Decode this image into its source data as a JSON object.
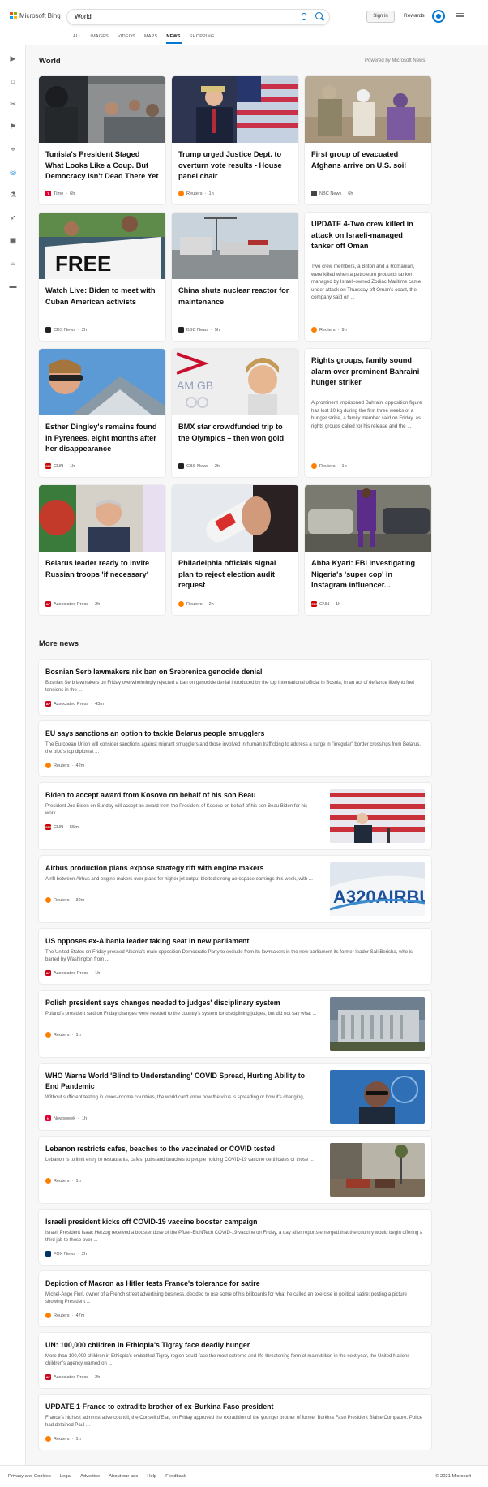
{
  "header": {
    "logo_text": "Microsoft Bing",
    "search_query": "World",
    "signin_label": "Sign in",
    "rewards_label": "Rewards",
    "tabs": [
      "ALL",
      "IMAGES",
      "VIDEOS",
      "MAPS",
      "NEWS",
      "SHOPPING"
    ],
    "active_tab": "NEWS"
  },
  "rail": [
    "expand-icon",
    "home-icon",
    "tools-icon",
    "flag-icon",
    "location-icon",
    "globe-icon",
    "science-icon",
    "rocket-icon",
    "entertainment-icon",
    "building-icon",
    "money-icon"
  ],
  "section": {
    "title": "World",
    "powered_by": "Powered by Microsoft News"
  },
  "cards": [
    {
      "title": "Tunisia's President Staged What Looks Like a Coup. But Democracy Isn't Dead There Yet",
      "snippet": "",
      "source": "Time",
      "age": "6h",
      "logo_color": "#e4002b"
    },
    {
      "title": "Trump urged Justice Dept. to overturn vote results - House panel chair",
      "snippet": "",
      "source": "Reuters",
      "age": "1h",
      "logo_color": "#ff8000"
    },
    {
      "title": "First group of evacuated Afghans arrive on U.S. soil",
      "snippet": "",
      "source": "NBC News",
      "age": "6h",
      "logo_color": "#444"
    },
    {
      "title": "Watch Live: Biden to meet with Cuban American activists",
      "snippet": "",
      "source": "CBS News",
      "age": "2h",
      "logo_color": "#222"
    },
    {
      "title": "China shuts nuclear reactor for maintenance",
      "snippet": "",
      "source": "BBC News",
      "age": "5h",
      "logo_color": "#222"
    },
    {
      "title": "UPDATE 4-Two crew killed in attack on Israeli-managed tanker off Oman",
      "snippet": "Two crew members, a Briton and a Romanian, were killed when a petroleum products tanker managed by Israeli-owned Zodiac Maritime came under attack on Thursday off Oman's coast, the company said on ...",
      "source": "Reuters",
      "age": "9h",
      "logo_color": "#ff8000"
    },
    {
      "title": "Esther Dingley's remains found in Pyrenees, eight months after her disappearance",
      "snippet": "",
      "source": "CNN",
      "age": "1h",
      "logo_color": "#cc0000"
    },
    {
      "title": "BMX star crowdfunded trip to the Olympics – then won gold",
      "snippet": "",
      "source": "CBS News",
      "age": "2h",
      "logo_color": "#222"
    },
    {
      "title": "Rights groups, family sound alarm over prominent Bahraini hunger striker",
      "snippet": "A prominent imprisoned Bahraini opposition figure has lost 10 kg during the first three weeks of a hunger strike, a family member said on Friday, as rights groups called for his release and the ...",
      "source": "Reuters",
      "age": "1h",
      "logo_color": "#ff8000"
    },
    {
      "title": "Belarus leader ready to invite Russian troops 'if necessary'",
      "snippet": "",
      "source": "Associated Press",
      "age": "2h",
      "logo_color": "#d0021b"
    },
    {
      "title": "Philadelphia officials signal plan to reject election audit request",
      "snippet": "",
      "source": "Reuters",
      "age": "2h",
      "logo_color": "#ff8000"
    },
    {
      "title": "Abba Kyari: FBI investigating Nigeria's 'super cop' in Instagram influencer...",
      "snippet": "",
      "source": "CNN",
      "age": "1h",
      "logo_color": "#cc0000"
    }
  ],
  "more_news": {
    "title": "More news",
    "items": [
      {
        "title": "Bosnian Serb lawmakers nix ban on Srebrenica genocide denial",
        "snippet": "Bosnian Serb lawmakers on Friday overwhelmingly rejected a ban on genocide denial introduced by the top international official in Bosnia, in an act of defiance likely to fuel tensions in the ...",
        "source": "Associated Press",
        "age": "43m",
        "logo_color": "#d0021b"
      },
      {
        "title": "EU says sanctions an option to tackle Belarus people smugglers",
        "snippet": "The European Union will consider sanctions against migrant smugglers and those involved in human trafficking to address a surge in \"irregular\" border crossings from Belarus, the bloc's top diplomat ...",
        "source": "Reuters",
        "age": "42m",
        "logo_color": "#ff8000"
      },
      {
        "title": "Biden to accept award from Kosovo on behalf of his son Beau",
        "snippet": "President Joe Biden on Sunday will accept an award from the President of Kosovo on behalf of his son Beau Biden for his work ...",
        "source": "CNN",
        "age": "55m",
        "logo_color": "#cc0000"
      },
      {
        "title": "Airbus production plans expose strategy rift with engine makers",
        "snippet": "A rift between Airbus and engine makers over plans for higher jet output blotted strong aerospace earnings this week, with ...",
        "source": "Reuters",
        "age": "32m",
        "logo_color": "#ff8000"
      },
      {
        "title": "US opposes ex-Albania leader taking seat in new parliament",
        "snippet": "The United States on Friday pressed Albania's main opposition Democratic Party to exclude from its lawmakers in the new parliament its former leader Sali Berisha, who is barred by Washington from ...",
        "source": "Associated Press",
        "age": "1h",
        "logo_color": "#d0021b"
      },
      {
        "title": "Polish president says changes needed to judges' disciplinary system",
        "snippet": "Poland's president said on Friday changes were needed to the country's system for disciplining judges, but did not say what ...",
        "source": "Reuters",
        "age": "1h",
        "logo_color": "#ff8000"
      },
      {
        "title": "WHO Warns World 'Blind to Understanding' COVID Spread, Hurting Ability to End Pandemic",
        "snippet": "Without sufficient testing in lower-income countries, the world can't know how the virus is spreading or how it's changing, ...",
        "source": "Newsweek",
        "age": "1h",
        "logo_color": "#e4002b"
      },
      {
        "title": "Lebanon restricts cafes, beaches to the vaccinated or COVID tested",
        "snippet": "Lebanon is to limit entry to restaurants, cafes, pubs and beaches to people holding COVID-19 vaccine certificates or those ...",
        "source": "Reuters",
        "age": "1h",
        "logo_color": "#ff8000"
      },
      {
        "title": "Israeli president kicks off COVID-19 vaccine booster campaign",
        "snippet": "Israeli President Isaac Herzog received a booster dose of the Pfizer-BioNTech COVID-19 vaccine on Friday, a day after reports emerged that the country would begin offering a third jab to those over ...",
        "source": "FOX News",
        "age": "2h",
        "logo_color": "#003366"
      },
      {
        "title": "Depiction of Macron as Hitler tests France's tolerance for satire",
        "snippet": "Michel-Ange Flori, owner of a French street advertising business, decided to use some of his billboards for what he called an exercise in political satire: posting a picture showing President ...",
        "source": "Reuters",
        "age": "47m",
        "logo_color": "#ff8000"
      },
      {
        "title": "UN: 100,000 children in Ethiopia's Tigray face deadly hunger",
        "snippet": "More than 100,000 children in Ethiopia's embattled Tigray region could face the most extreme and life-threatening form of malnutrition in the next year, the United Nations children's agency warned on ...",
        "source": "Associated Press",
        "age": "2h",
        "logo_color": "#d0021b"
      },
      {
        "title": "UPDATE 1-France to extradite brother of ex-Burkina Faso president",
        "snippet": "France's highest administrative council, the Conseil d'Etat, on Friday approved the extradition of the younger brother of former Burkina Faso President Blaise Compaore. Police had detained Paul ...",
        "source": "Reuters",
        "age": "1h",
        "logo_color": "#ff8000"
      }
    ]
  },
  "footer": {
    "links": [
      "Privacy and Cookies",
      "Legal",
      "Advertise",
      "About our ads",
      "Help",
      "Feedback"
    ],
    "copyright": "© 2021 Microsoft"
  },
  "colors": {
    "accent": "#0078d4",
    "background": "#f7f7f7"
  }
}
